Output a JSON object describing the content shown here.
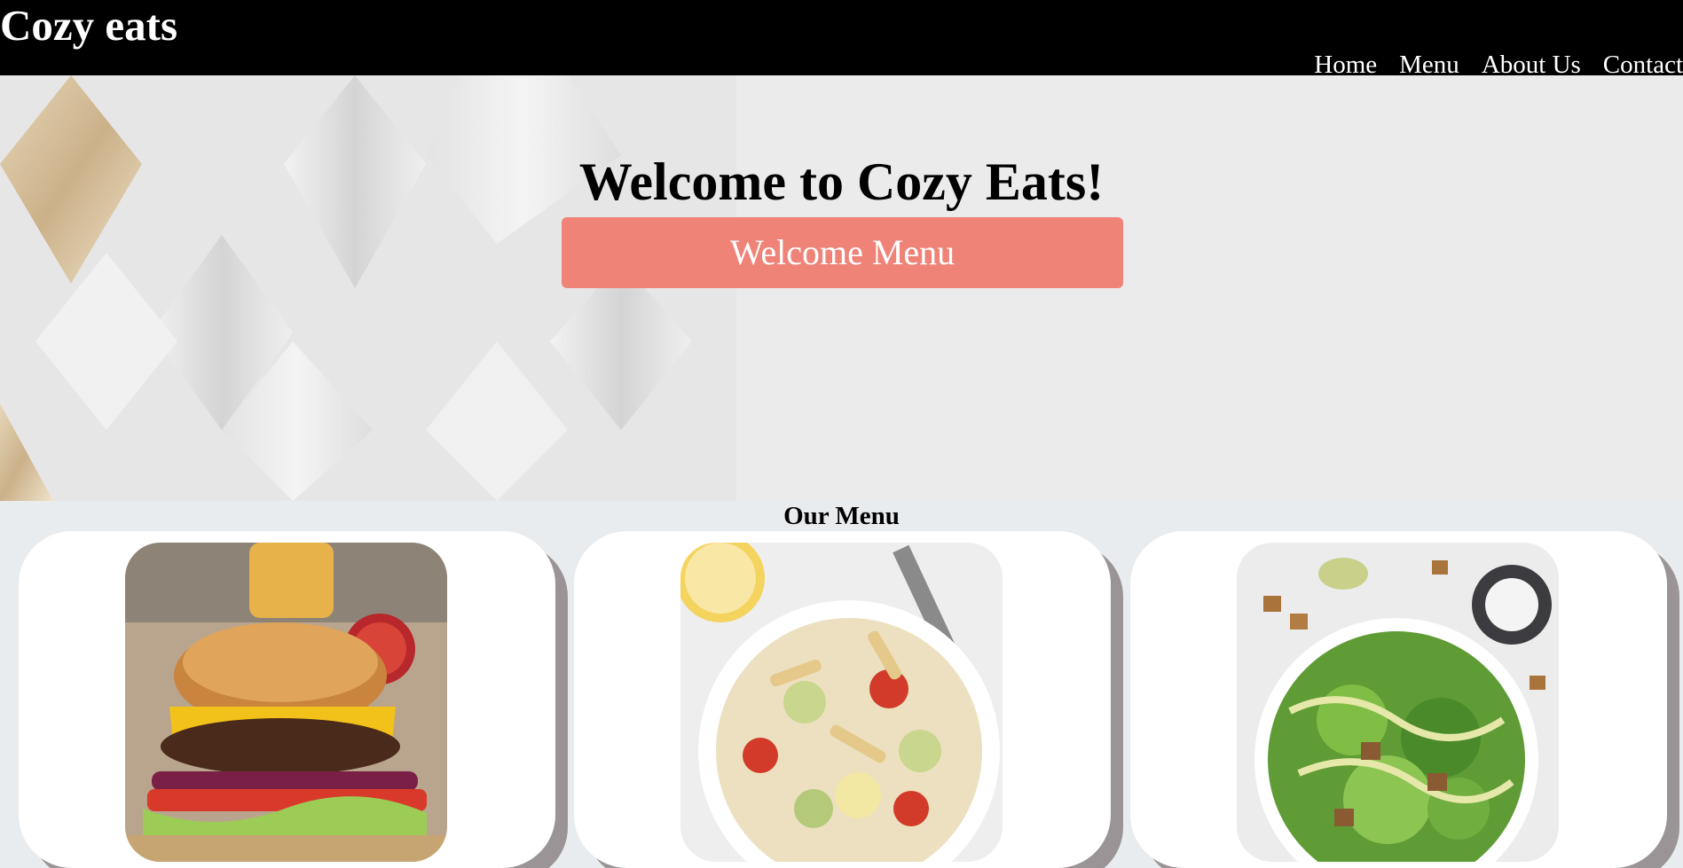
{
  "header": {
    "brand": "Cozy eats",
    "nav": [
      {
        "label": "Home"
      },
      {
        "label": "Menu"
      },
      {
        "label": "About Us"
      },
      {
        "label": "Contact"
      }
    ]
  },
  "hero": {
    "title": "Welcome to Cozy Eats!",
    "button_label": "Welcome Menu"
  },
  "menu": {
    "title": "Our Menu",
    "items": [
      {
        "image": "burger-photo"
      },
      {
        "image": "pasta-salad-photo"
      },
      {
        "image": "caesar-salad-photo"
      }
    ]
  },
  "colors": {
    "header_bg": "#000000",
    "button_bg": "#ef8378",
    "page_bg": "#e9ecef",
    "card_shadow": "#9a9496"
  }
}
